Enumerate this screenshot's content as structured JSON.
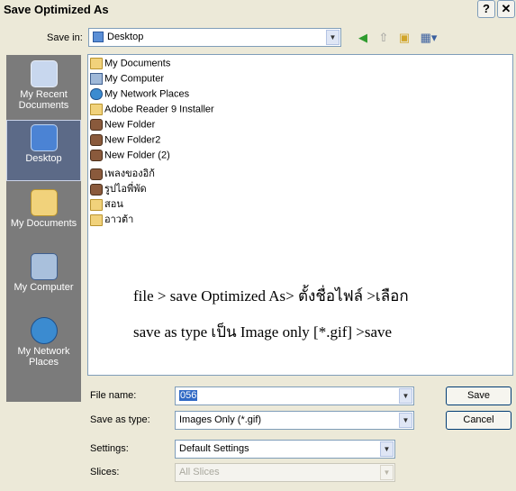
{
  "window": {
    "title": "Save Optimized As",
    "help_glyph": "?",
    "close_glyph": "✕"
  },
  "toolbar": {
    "save_in_label": "Save in:",
    "location": "Desktop"
  },
  "places": [
    {
      "label": "My Recent Documents",
      "icon": "recent-documents-icon"
    },
    {
      "label": "Desktop",
      "icon": "desktop-icon"
    },
    {
      "label": "My Documents",
      "icon": "my-documents-icon"
    },
    {
      "label": "My Computer",
      "icon": "my-computer-icon"
    },
    {
      "label": "My Network Places",
      "icon": "network-places-icon"
    }
  ],
  "files": [
    {
      "name": "My Documents",
      "icon": "folder-icon"
    },
    {
      "name": "My Computer",
      "icon": "computer-icon"
    },
    {
      "name": "My Network Places",
      "icon": "network-icon"
    },
    {
      "name": "Adobe Reader 9 Installer",
      "icon": "folder-icon"
    },
    {
      "name": "New Folder",
      "icon": "photo-folder-icon"
    },
    {
      "name": "New Folder2",
      "icon": "photo-folder-icon"
    },
    {
      "name": "New Folder (2)",
      "icon": "photo-folder-icon"
    },
    {
      "name": "เพลงของอิก้",
      "icon": "photo-folder-icon"
    },
    {
      "name": "รูปไอพี่พัด",
      "icon": "photo-folder-icon"
    },
    {
      "name": "สอน",
      "icon": "folder-icon"
    },
    {
      "name": "อาวต้า",
      "icon": "folder-icon"
    }
  ],
  "annotation": {
    "line1": "file > save Optimized As> ตั้งชื่อไฟล์ >เลือก",
    "line2": "save as type เป็น Image only [*.gif] >save"
  },
  "form": {
    "file_name_label": "File name:",
    "file_name_value": "056",
    "save_as_type_label": "Save as type:",
    "save_as_type_value": "Images Only (*.gif)",
    "settings_label": "Settings:",
    "settings_value": "Default Settings",
    "slices_label": "Slices:",
    "slices_value": "All Slices"
  },
  "buttons": {
    "save": "Save",
    "cancel": "Cancel"
  }
}
